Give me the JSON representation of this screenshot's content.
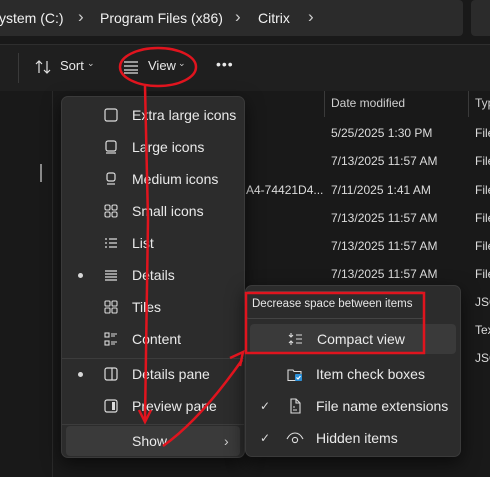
{
  "breadcrumb": [
    "ystem (C:)",
    "Program Files (x86)",
    "Citrix"
  ],
  "toolbar": {
    "sort_label": "Sort",
    "view_label": "View",
    "more_label": "•••"
  },
  "columns": {
    "date_modified": "Date modified",
    "type": "Typ"
  },
  "rows": [
    {
      "fragment": "",
      "date": "5/25/2025 1:30 PM",
      "type": "File"
    },
    {
      "fragment": "",
      "date": "7/13/2025 11:57 AM",
      "type": "File"
    },
    {
      "fragment": "A4-74421D4...",
      "date": "7/11/2025 1:41 AM",
      "type": "File"
    },
    {
      "fragment": "",
      "date": "7/13/2025 11:57 AM",
      "type": "File"
    },
    {
      "fragment": "",
      "date": "7/13/2025 11:57 AM",
      "type": "File"
    },
    {
      "fragment": "",
      "date": "7/13/2025 11:57 AM",
      "type": "File"
    },
    {
      "fragment": "",
      "date": "",
      "type": "JSO"
    },
    {
      "fragment": "",
      "date": "",
      "type": "Tex"
    },
    {
      "fragment": "",
      "date": "",
      "type": "JSO"
    }
  ],
  "view_menu": {
    "items": [
      {
        "label": "Extra large icons",
        "icon": "extra-large-icons-icon",
        "selected": false
      },
      {
        "label": "Large icons",
        "icon": "large-icons-icon",
        "selected": false
      },
      {
        "label": "Medium icons",
        "icon": "medium-icons-icon",
        "selected": false
      },
      {
        "label": "Small icons",
        "icon": "small-icons-icon",
        "selected": false
      },
      {
        "label": "List",
        "icon": "list-icon",
        "selected": false
      },
      {
        "label": "Details",
        "icon": "details-icon",
        "selected": true
      },
      {
        "label": "Tiles",
        "icon": "tiles-icon",
        "selected": false
      },
      {
        "label": "Content",
        "icon": "content-icon",
        "selected": false
      }
    ],
    "panes": [
      {
        "label": "Details pane",
        "icon": "details-pane-icon",
        "selected": true
      },
      {
        "label": "Preview pane",
        "icon": "preview-pane-icon",
        "selected": false
      }
    ],
    "show_label": "Show"
  },
  "show_submenu": {
    "tooltip": "Decrease space between items",
    "items": [
      {
        "label": "Compact view",
        "icon": "compact-view-icon",
        "checked": false
      },
      {
        "label": "Item check boxes",
        "icon": "item-check-boxes-icon",
        "checked": false
      },
      {
        "label": "File name extensions",
        "icon": "file-extension-icon",
        "checked": true
      },
      {
        "label": "Hidden items",
        "icon": "eye-icon",
        "checked": true
      }
    ]
  },
  "colors": {
    "annotation": "#e0141e",
    "menu_bg": "#2c2c2c",
    "window_bg": "#191919",
    "highlight": "#3a3a3a"
  }
}
